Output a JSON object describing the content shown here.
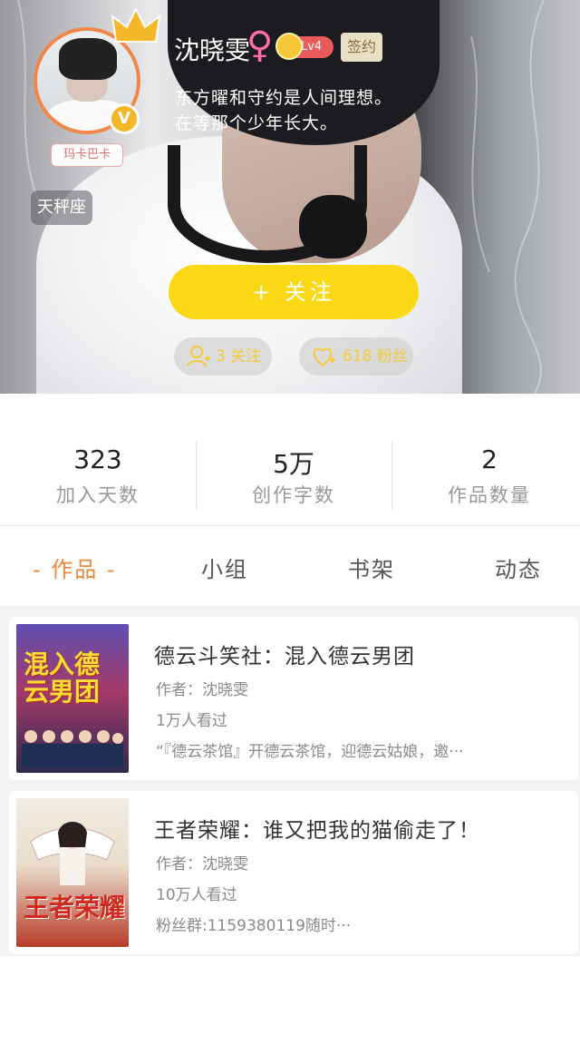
{
  "profile": {
    "username": "沈晓雯",
    "gender_icon": "female-icon",
    "level": "Lv4",
    "signed_label": "签约",
    "nick_tag": "玛卡巴卡",
    "zodiac": "天秤座",
    "bio_line1": "东方曜和守约是人间理想。",
    "bio_line2": "在等那个少年长大。",
    "follow_button": "+  关注",
    "following_text": "3 关注",
    "fans_text": "618 粉丝",
    "accent_color": "#fad816"
  },
  "stats": [
    {
      "value": "323",
      "label": "加入天数"
    },
    {
      "value": "5万",
      "label": "创作字数"
    },
    {
      "value": "2",
      "label": "作品数量"
    }
  ],
  "tabs": [
    {
      "label": "- 作品 -",
      "active": true
    },
    {
      "label": "小组"
    },
    {
      "label": "书架"
    },
    {
      "label": "动态"
    }
  ],
  "works": [
    {
      "title": "德云斗笑社：混入德云男团",
      "author": "作者：沈晓雯",
      "readers": "1万人看过",
      "description": "“『德云茶馆』开德云茶馆，迎德云姑娘，邀···",
      "cover_text": "混入德云男团"
    },
    {
      "title": "王者荣耀：谁又把我的猫偷走了！",
      "author": "作者：沈晓雯",
      "readers": "10万人看过",
      "description": "粉丝群:1159380119随时···",
      "cover_text": "王者荣耀"
    }
  ]
}
